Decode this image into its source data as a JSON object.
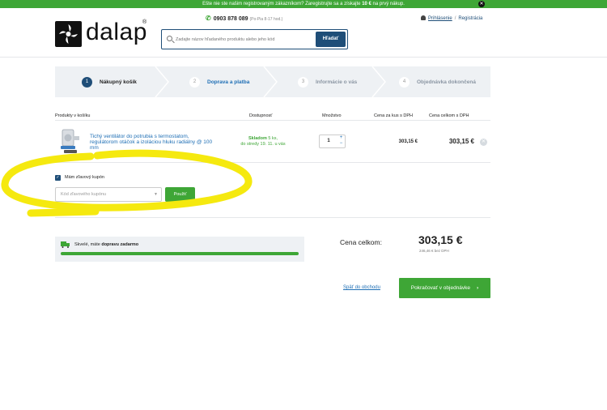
{
  "banner": {
    "prefix": "Ešte nie ste našim registrovaným zákazníkom? Zaregistrujte sa a získajte ",
    "highlight": "10 €",
    "suffix": " na prvý nákup."
  },
  "header": {
    "logo_text": "dalap",
    "logo_reg": "®",
    "phone": "0903 878 089",
    "phone_hours": "(Po-Pia 8-17 hod.)",
    "search_placeholder": "Zadajte názov hľadaného produktu alebo jeho kód",
    "search_button": "Hľadať",
    "login": "Prihlásenie",
    "login_sep": "/",
    "register": "Registrácia"
  },
  "steps": [
    {
      "num": "1",
      "label": "Nákupný košík"
    },
    {
      "num": "2",
      "label": "Doprava a platba"
    },
    {
      "num": "3",
      "label": "Informácie o vás"
    },
    {
      "num": "4",
      "label": "Objednávka dokončená"
    }
  ],
  "table": {
    "col_products": "Produkty v košíku",
    "col_availability": "Dostupnosť",
    "col_quantity": "Množstvo",
    "col_unit_price": "Cena za kus s DPH",
    "col_total": "Cena celkom s DPH"
  },
  "item": {
    "name": "Tichý ventilátor do potrubia s termostatom, regulátorom otáčok a izoláciou hluku radiálny @ 100 mm",
    "stock_bold": "Skladom",
    "stock_rest": " 5 ks,",
    "delivery": "do stredy 19. 11. u vás",
    "quantity": "1",
    "qty_up": "+",
    "qty_down": "−",
    "unit_price": "303,15 €",
    "total_price": "303,15 €"
  },
  "coupon": {
    "checkbox_label": "Mám zľavový kupón",
    "select_placeholder": "Kód zľavového kupónu",
    "apply_button": "Použiť"
  },
  "shipping": {
    "text_prefix": "Skvelé, máte ",
    "text_bold": "dopravu zadarmo",
    "progress": 1.0
  },
  "summary": {
    "label": "Cena celkom:",
    "amount": "303,15 €",
    "without_vat": "246,46 € bez DPH"
  },
  "actions": {
    "back": "Späť do obchodu",
    "continue": "Pokračovať v objednávke",
    "continue_arrow": "›"
  },
  "colors": {
    "green": "#3ea636",
    "navy": "#1f4e78",
    "link_blue": "#1f6fb5",
    "annotation_yellow": "#f5e90f"
  }
}
